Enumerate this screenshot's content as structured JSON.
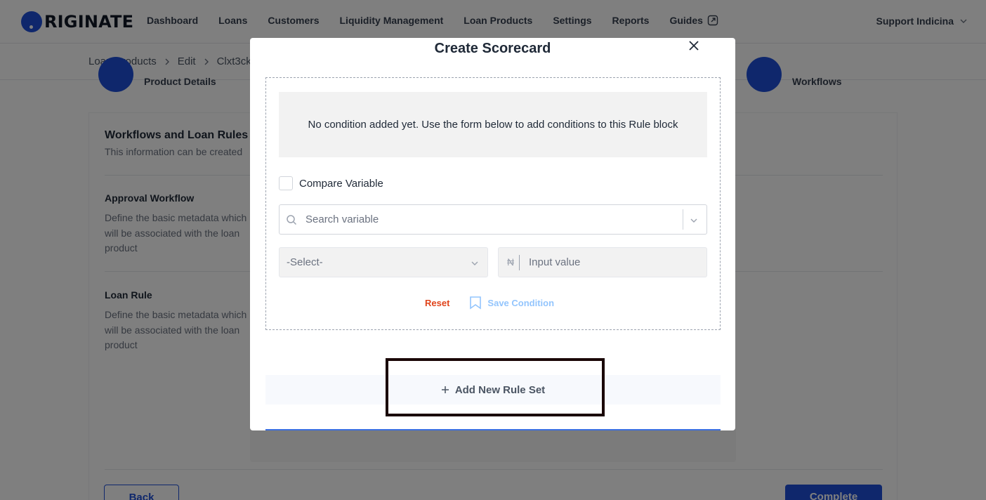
{
  "brand": {
    "logo_text": "RIGINATE"
  },
  "nav": {
    "items": [
      "Dashboard",
      "Loans",
      "Customers",
      "Liquidity Management",
      "Loan Products",
      "Settings",
      "Reports",
      "Guides"
    ],
    "user": "Support Indicina"
  },
  "breadcrumb": {
    "items": [
      "Loan Products",
      "Edit",
      "Clxt3ck"
    ]
  },
  "stepper": {
    "steps": [
      "Product Details",
      "Workflows"
    ]
  },
  "page": {
    "title": "Workflows and Loan Rules",
    "subtitle": "This information can be created",
    "sections": [
      {
        "title": "Approval Workflow",
        "desc": "Define the basic metadata which will be associated with the loan product"
      },
      {
        "title": "Loan Rule",
        "desc": "Define the basic metadata which will be associated with the loan product"
      }
    ],
    "back_label": "Back",
    "complete_label": "Complete"
  },
  "modal": {
    "title": "Create Scorecard",
    "empty_message": "No condition added yet. Use the form below to add conditions to this Rule block",
    "compare_label": "Compare Variable",
    "search_placeholder": "Search variable",
    "select_value": "-Select-",
    "currency_symbol": "₦",
    "input_placeholder": "Input value",
    "reset_label": "Reset",
    "save_condition_label": "Save Condition",
    "add_rule_set_label": "Add New Rule Set"
  },
  "colors": {
    "primary": "#1e4fd8",
    "danger": "#e0441b",
    "disabled_blue": "#93c5fd"
  }
}
